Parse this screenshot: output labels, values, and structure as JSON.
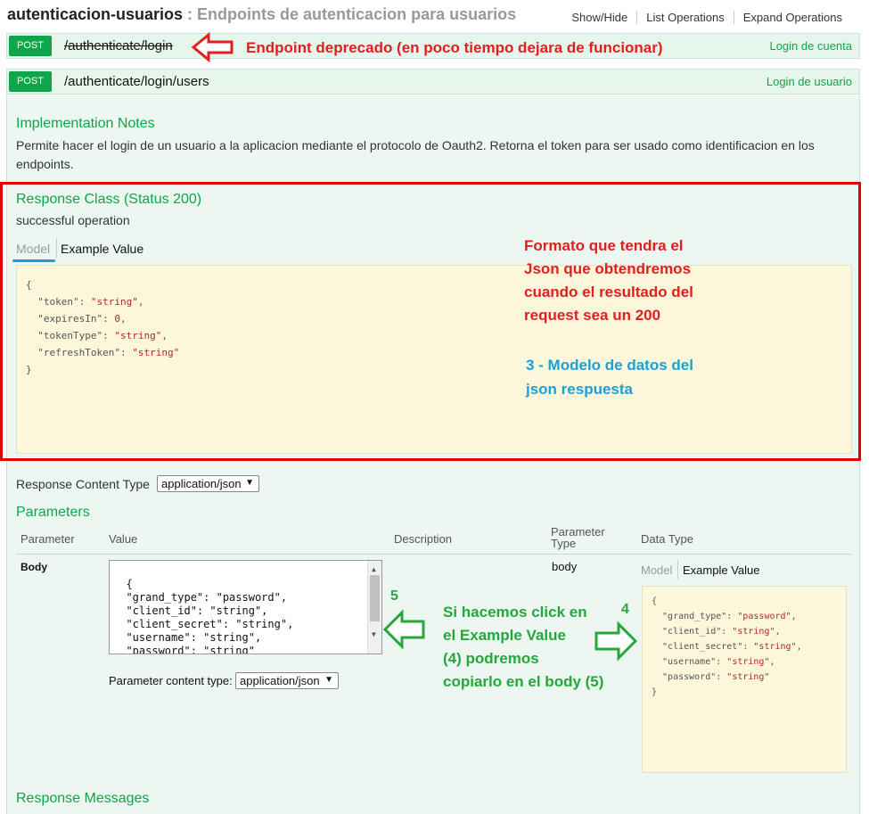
{
  "header": {
    "title": "autenticacion-usuarios",
    "separator": " : ",
    "description": "Endpoints de autenticacion para usuarios",
    "links": [
      "Show/Hide",
      "List Operations",
      "Expand Operations"
    ]
  },
  "ops": [
    {
      "method": "POST",
      "path": "/authenticate/login",
      "summary": "Login de cuenta"
    },
    {
      "method": "POST",
      "path": "/authenticate/login/users",
      "summary": "Login de usuario"
    }
  ],
  "impl": {
    "heading": "Implementation Notes",
    "text": "Permite hacer el login de un usuario a la aplicacion mediante el protocolo de Oauth2. Retorna el token para ser usado como identificacion en los endpoints."
  },
  "response_class": {
    "heading": "Response Class (Status 200)",
    "subtext": "successful operation",
    "tab_model": "Model",
    "tab_example": "Example Value",
    "lines": [
      [
        {
          "t": "{",
          "c": "k"
        }
      ],
      [
        {
          "t": "  \"token\"",
          "c": "k"
        },
        {
          "t": ": ",
          "c": "k"
        },
        {
          "t": "\"string\"",
          "c": "sv"
        },
        {
          "t": ",",
          "c": "k"
        }
      ],
      [
        {
          "t": "  \"expiresIn\"",
          "c": "k"
        },
        {
          "t": ": ",
          "c": "k"
        },
        {
          "t": "0",
          "c": "sv"
        },
        {
          "t": ",",
          "c": "k"
        }
      ],
      [
        {
          "t": "  \"tokenType\"",
          "c": "k"
        },
        {
          "t": ": ",
          "c": "k"
        },
        {
          "t": "\"string\"",
          "c": "sv"
        },
        {
          "t": ",",
          "c": "k"
        }
      ],
      [
        {
          "t": "  \"refreshToken\"",
          "c": "k"
        },
        {
          "t": ": ",
          "c": "k"
        },
        {
          "t": "\"string\"",
          "c": "sv"
        }
      ],
      [
        {
          "t": "}",
          "c": "k"
        }
      ]
    ]
  },
  "response_content_type": {
    "label": "Response Content Type",
    "value": "application/json"
  },
  "parameters": {
    "heading": "Parameters",
    "columns": [
      "Parameter",
      "Value",
      "Description",
      "Parameter Type",
      "Data Type"
    ],
    "row": {
      "name": "Body",
      "value": "{\n  \"grand_type\": \"password\",\n  \"client_id\": \"string\",\n  \"client_secret\": \"string\",\n  \"username\": \"string\",\n  \"password\": \"string\"\n}",
      "param_type": "body",
      "content_type_label": "Parameter content type:",
      "content_type_value": "application/json"
    },
    "datatype": {
      "tab_model": "Model",
      "tab_example": "Example Value",
      "lines": [
        [
          {
            "t": "{",
            "c": "k"
          }
        ],
        [
          {
            "t": "  \"grand_type\"",
            "c": "k"
          },
          {
            "t": ": ",
            "c": "k"
          },
          {
            "t": "\"password\"",
            "c": "sv"
          },
          {
            "t": ",",
            "c": "k"
          }
        ],
        [
          {
            "t": "  \"client_id\"",
            "c": "k"
          },
          {
            "t": ": ",
            "c": "k"
          },
          {
            "t": "\"string\"",
            "c": "sv"
          },
          {
            "t": ",",
            "c": "k"
          }
        ],
        [
          {
            "t": "  \"client_secret\"",
            "c": "k"
          },
          {
            "t": ": ",
            "c": "k"
          },
          {
            "t": "\"string\"",
            "c": "sv"
          },
          {
            "t": ",",
            "c": "k"
          }
        ],
        [
          {
            "t": "  \"username\"",
            "c": "k"
          },
          {
            "t": ": ",
            "c": "k"
          },
          {
            "t": "\"string\"",
            "c": "sv"
          },
          {
            "t": ",",
            "c": "k"
          }
        ],
        [
          {
            "t": "  \"password\"",
            "c": "k"
          },
          {
            "t": ": ",
            "c": "k"
          },
          {
            "t": "\"string\"",
            "c": "sv"
          }
        ],
        [
          {
            "t": "}",
            "c": "k"
          }
        ]
      ]
    }
  },
  "response_messages": {
    "heading": "Response Messages"
  },
  "annotations": {
    "deprecated": "Endpoint deprecado (en poco tiempo dejara de funcionar)",
    "format": [
      "Formato que tendra el",
      "Json que obtendremos",
      "cuando el resultado del",
      "request sea un 200"
    ],
    "model": [
      "3 - Modelo de datos del",
      "json respuesta"
    ],
    "num3": "3",
    "num4": "4",
    "num5": "5",
    "copy": [
      "Si hacemos click en",
      "el Example Value",
      "(4) podremos",
      "copiarlo en el body (5)"
    ]
  },
  "colors": {
    "post": "#10a54a",
    "annotation_red": "#e02020",
    "annotation_blue": "#1aa0d8",
    "annotation_green": "#24a83a"
  }
}
